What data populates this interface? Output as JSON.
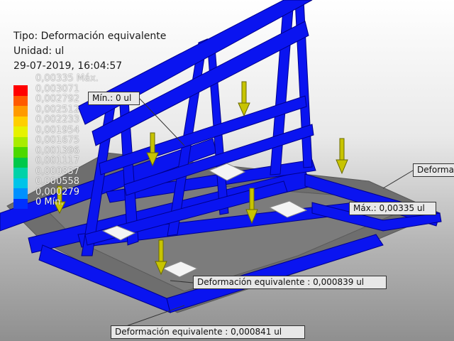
{
  "header": {
    "type_line": "Tipo: Deformación equivalente",
    "unit_line": "Unidad: ul",
    "date_line": "29-07-2019, 16:04:57"
  },
  "legend": {
    "max_label": "0,00335 Máx.",
    "min_label": "0 Mín.",
    "ticks": [
      "0,003071",
      "0,002792",
      "0,002512",
      "0,002233",
      "0,001954",
      "0,001675",
      "0,001396",
      "0,001117",
      "0,000837",
      "0,000558",
      "0,000279"
    ],
    "colors": [
      "#ff0000",
      "#ff5a00",
      "#ff9a00",
      "#ffcf00",
      "#e6f200",
      "#a8ec00",
      "#4cd800",
      "#00c84a",
      "#00d2a8",
      "#00c4e8",
      "#0090ff",
      "#0030ff"
    ]
  },
  "probes": {
    "min": "Mín.: 0 ul",
    "max": "Máx.: 0,00335 ul",
    "right": "Deformac",
    "center": "Deformación equivalente : 0,000839 ul",
    "bottom": "Deformación equivalente : 0,000841 ul"
  },
  "model": {
    "frame_color": "#0a14f0",
    "arrow_color": "#c8c400",
    "pad_color": "#f4f4f4"
  }
}
